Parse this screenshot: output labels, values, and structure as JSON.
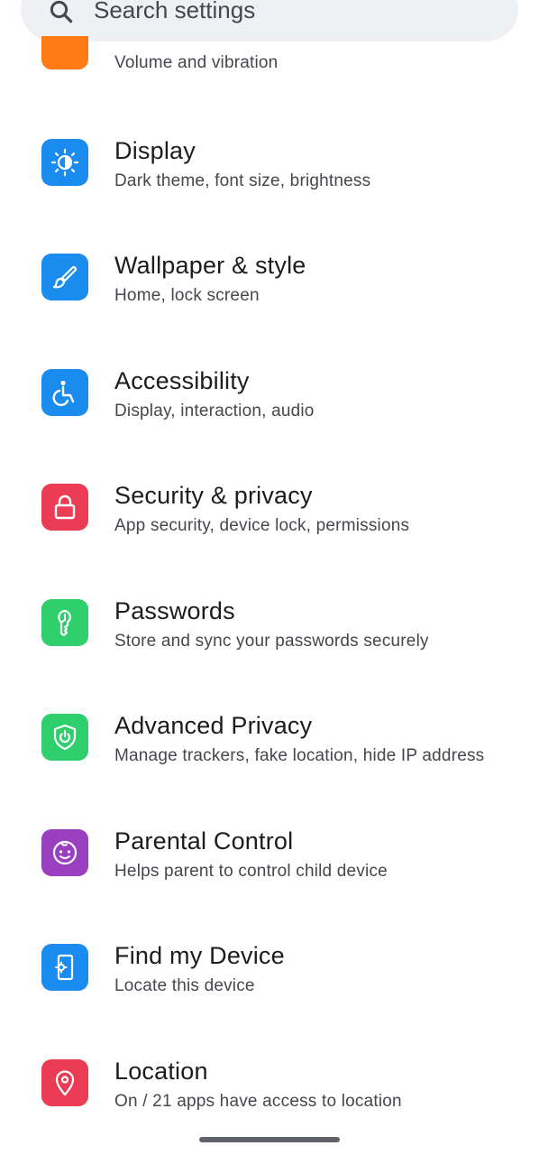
{
  "search": {
    "placeholder": "Search settings",
    "icon": "search-icon"
  },
  "partial_item": {
    "subtitle": "Volume and vibration",
    "color": "#ff7a14"
  },
  "items": [
    {
      "title": "Display",
      "subtitle": "Dark theme, font size, brightness",
      "icon": "brightness-icon",
      "color": "#1a8cf0"
    },
    {
      "title": "Wallpaper & style",
      "subtitle": "Home, lock screen",
      "icon": "brush-icon",
      "color": "#1a8cf0"
    },
    {
      "title": "Accessibility",
      "subtitle": "Display, interaction, audio",
      "icon": "accessibility-icon",
      "color": "#1a8cf0"
    },
    {
      "title": "Security & privacy",
      "subtitle": "App security, device lock, permissions",
      "icon": "lock-icon",
      "color": "#ea3d55"
    },
    {
      "title": "Passwords",
      "subtitle": "Store and sync your passwords securely",
      "icon": "key-icon",
      "color": "#2fcf6d"
    },
    {
      "title": "Advanced Privacy",
      "subtitle": "Manage trackers, fake location, hide IP address",
      "icon": "shield-power-icon",
      "color": "#2fcf6d"
    },
    {
      "title": "Parental Control",
      "subtitle": "Helps parent to control child device",
      "icon": "child-face-icon",
      "color": "#9b3fc1"
    },
    {
      "title": "Find my Device",
      "subtitle": "Locate this device",
      "icon": "find-device-icon",
      "color": "#1a8cf0"
    },
    {
      "title": "Location",
      "subtitle": "On / 21 apps have access to location",
      "icon": "location-pin-icon",
      "color": "#ea3d55"
    }
  ]
}
